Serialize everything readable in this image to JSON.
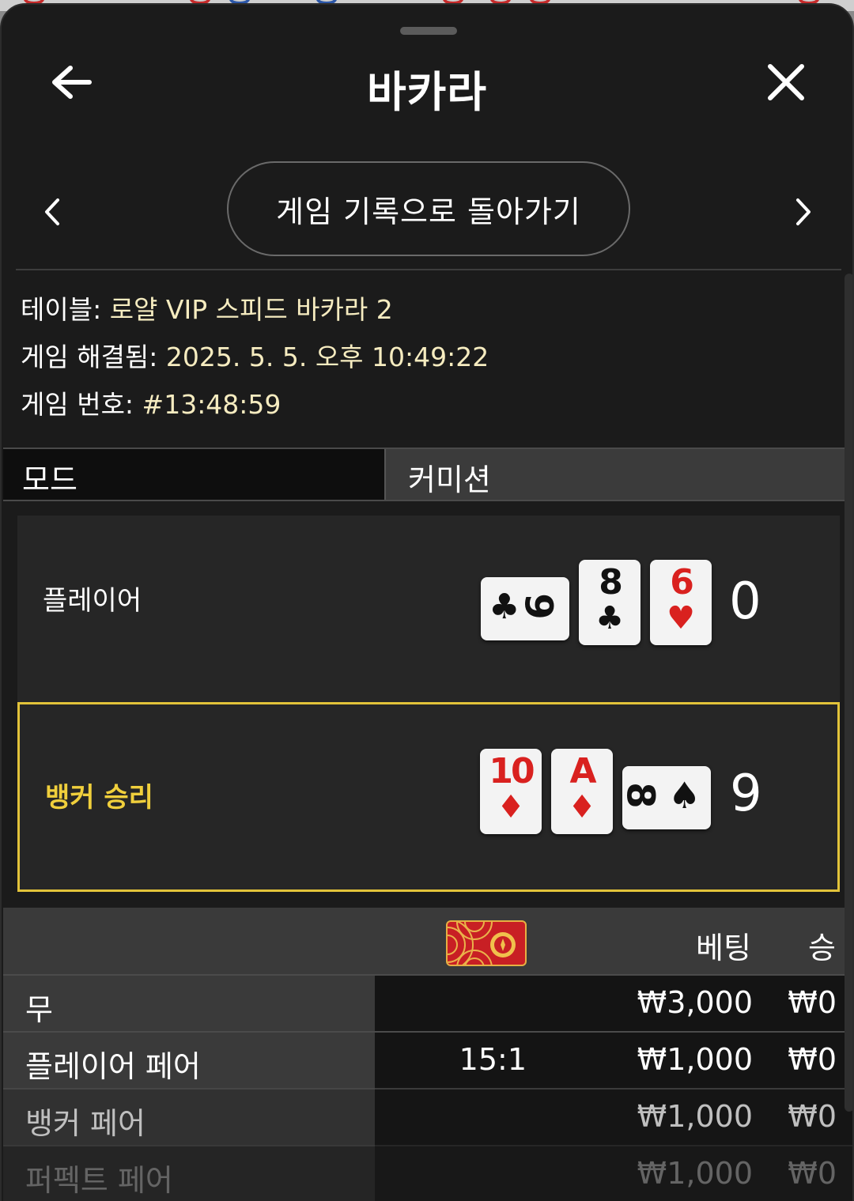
{
  "header": {
    "title": "바카라",
    "back_icon": "arrow-left-icon",
    "close_icon": "close-icon"
  },
  "nav": {
    "back_to_history": "게임 기록으로 돌아가기",
    "prev_icon": "chevron-left-icon",
    "next_icon": "chevron-right-icon"
  },
  "info": {
    "table_label": "테이블:",
    "table_value": " 로얄 VIP 스피드 바카라 2",
    "resolved_label": "게임 해결됨:",
    "resolved_value": " 2025. 5. 5. 오후 10:49:22",
    "number_label": "게임 번호:",
    "number_value": " #13:48:59"
  },
  "mode": {
    "label": "모드",
    "value": "커미션"
  },
  "hands": {
    "player": {
      "label": "플레이어",
      "score": "0",
      "cards": [
        {
          "rank": "9",
          "suit": "♣",
          "orientation": "sideways"
        },
        {
          "rank": "8",
          "suit": "♣",
          "orientation": "upright"
        },
        {
          "rank": "6",
          "suit": "♥",
          "orientation": "upright"
        }
      ]
    },
    "banker": {
      "label": "뱅커 승리",
      "score": "9",
      "cards": [
        {
          "rank": "10",
          "suit": "♦",
          "orientation": "upright"
        },
        {
          "rank": "A",
          "suit": "♦",
          "orientation": "upright"
        },
        {
          "rank": "8",
          "suit": "♠",
          "orientation": "sideways"
        }
      ]
    }
  },
  "bets": {
    "headers": {
      "bet": "베팅",
      "win": "승"
    },
    "rows": [
      {
        "name": "무",
        "odds": "",
        "bet": "₩3,000",
        "win": "₩0"
      },
      {
        "name": "플레이어 페어",
        "odds": "15:1",
        "bet": "₩1,000",
        "win": "₩0"
      },
      {
        "name": "뱅커 페어",
        "odds": "",
        "bet": "₩1,000",
        "win": "₩0"
      },
      {
        "name": "퍼펙트 페어",
        "odds": "",
        "bet": "₩1,000",
        "win": "₩0"
      }
    ]
  },
  "colors": {
    "accent_yellow": "#f0cf3c",
    "info_value": "#f6ecc0",
    "card_red": "#d9211f"
  }
}
